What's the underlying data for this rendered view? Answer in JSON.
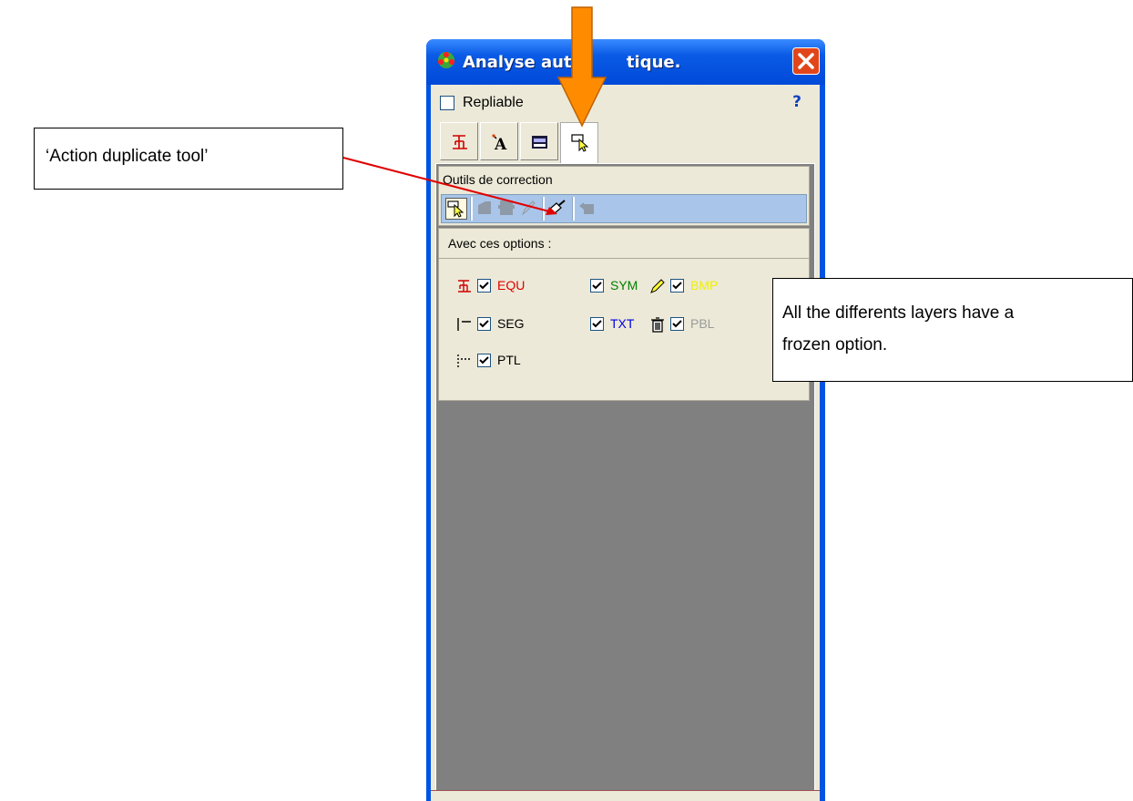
{
  "window": {
    "title": "Analyse automatique.",
    "title_visible": "Analyse auto",
    "title_tail": "tique."
  },
  "options_bar": {
    "repliable_label": "Repliable",
    "help_label": "?"
  },
  "tabs": [
    {
      "icon": "equation-icon"
    },
    {
      "icon": "text-icon"
    },
    {
      "icon": "image-icon"
    },
    {
      "icon": "cursor-select-icon",
      "active": true
    }
  ],
  "tools": {
    "title": "Outils de correction",
    "buttons": [
      "cursor-select-icon",
      "layer-up-icon",
      "layer-block-icon",
      "pencil-icon",
      "brush-duplicate-icon",
      "move-layer-icon"
    ]
  },
  "options": {
    "title": "Avec ces options :",
    "layers": [
      {
        "name": "EQU",
        "color": "#e00000",
        "icon": "equation-icon",
        "checked": true
      },
      {
        "name": "SYM",
        "color": "#008000",
        "icon": "",
        "checked": true
      },
      {
        "name": "BMP",
        "color": "#f0f000",
        "icon": "pencil-icon",
        "checked": true
      },
      {
        "name": "SEG",
        "color": "#000000",
        "icon": "segment-icon",
        "checked": true
      },
      {
        "name": "TXT",
        "color": "#0000e0",
        "icon": "",
        "checked": true
      },
      {
        "name": "PBL",
        "color": "#9a9a9a",
        "icon": "trash-icon",
        "checked": true
      },
      {
        "name": "PTL",
        "color": "#000000",
        "icon": "dotted-line-icon",
        "checked": true
      }
    ]
  },
  "annotations": {
    "left_callout": "‘Action duplicate tool’",
    "right_callout_line1": "All the differents layers have a",
    "right_callout_line2": "frozen option."
  },
  "colors": {
    "titlebar": "#0054e3",
    "panel_bg": "#ece9d8",
    "toolbar": "#a9c6ea",
    "arrow_orange": "#ff8c00",
    "arrow_red": "#e00000"
  }
}
